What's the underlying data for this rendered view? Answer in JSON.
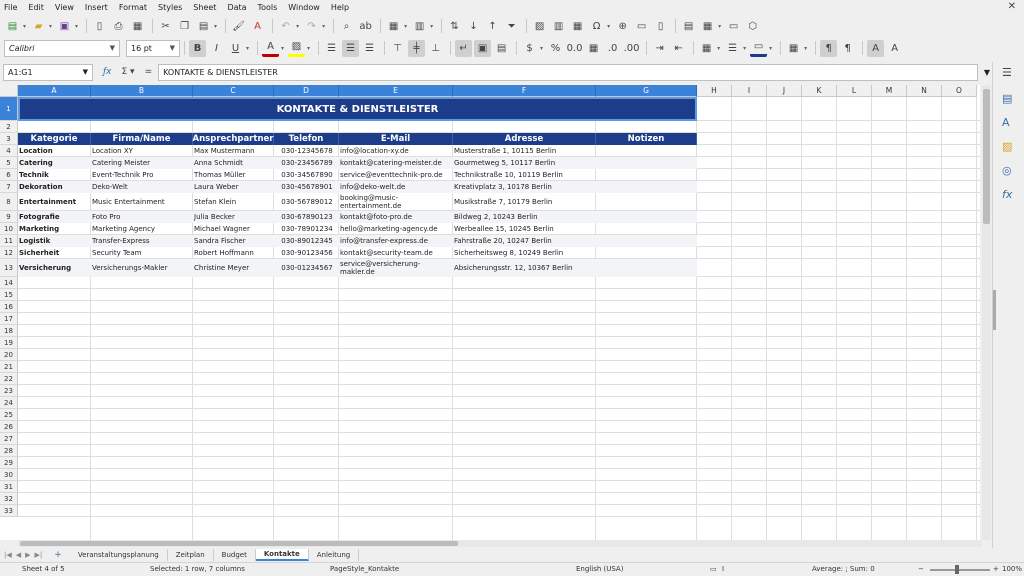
{
  "menu": [
    "File",
    "Edit",
    "View",
    "Insert",
    "Format",
    "Styles",
    "Sheet",
    "Data",
    "Tools",
    "Window",
    "Help"
  ],
  "font": {
    "name": "Calibri",
    "size": "16 pt"
  },
  "formula_bar": {
    "name_box": "A1:G1",
    "content": "KONTAKTE & DIENSTLEISTER"
  },
  "columns": [
    "A",
    "B",
    "C",
    "D",
    "E",
    "F",
    "G",
    "H",
    "I",
    "J",
    "K",
    "L",
    "M",
    "N",
    "O"
  ],
  "rows": [
    "1",
    "2",
    "3",
    "4",
    "5",
    "6",
    "7",
    "8",
    "9",
    "10",
    "11",
    "12",
    "13",
    "14",
    "15",
    "16",
    "17",
    "18",
    "19",
    "20",
    "21",
    "22",
    "23",
    "24",
    "25",
    "26",
    "27",
    "28",
    "29",
    "30",
    "31",
    "32",
    "33"
  ],
  "sheet": {
    "title": "KONTAKTE & DIENSTLEISTER",
    "headers": [
      "Kategorie",
      "Firma/Name",
      "Ansprechpartner",
      "Telefon",
      "E-Mail",
      "Adresse",
      "Notizen"
    ],
    "data": [
      [
        "Location",
        "Location XY",
        "Max Mustermann",
        "030-12345678",
        "info@location-xy.de",
        "Musterstraße 1, 10115 Berlin",
        ""
      ],
      [
        "Catering",
        "Catering Meister",
        "Anna Schmidt",
        "030-23456789",
        "kontakt@catering-meister.de",
        "Gourmetweg 5, 10117 Berlin",
        ""
      ],
      [
        "Technik",
        "Event-Technik Pro",
        "Thomas Müller",
        "030-34567890",
        "service@eventtechnik-pro.de",
        "Technikstraße 10, 10119 Berlin",
        ""
      ],
      [
        "Dekoration",
        "Deko-Welt",
        "Laura Weber",
        "030-45678901",
        "info@deko-welt.de",
        "Kreativplatz 3, 10178 Berlin",
        ""
      ],
      [
        "Entertainment",
        "Music Entertainment",
        "Stefan Klein",
        "030-56789012",
        "booking@music-entertainment.de",
        "Musikstraße 7, 10179 Berlin",
        ""
      ],
      [
        "Fotografie",
        "Foto Pro",
        "Julia Becker",
        "030-67890123",
        "kontakt@foto-pro.de",
        "Bildweg 2, 10243 Berlin",
        ""
      ],
      [
        "Marketing",
        "Marketing Agency",
        "Michael Wagner",
        "030-78901234",
        "hello@marketing-agency.de",
        "Werbeallee 15, 10245 Berlin",
        ""
      ],
      [
        "Logistik",
        "Transfer-Express",
        "Sandra Fischer",
        "030-89012345",
        "info@transfer-express.de",
        "Fahrstraße 20, 10247 Berlin",
        ""
      ],
      [
        "Sicherheit",
        "Security Team",
        "Robert Hoffmann",
        "030-90123456",
        "kontakt@security-team.de",
        "Sicherheitsweg 8, 10249 Berlin",
        ""
      ],
      [
        "Versicherung",
        "Versicherungs-Makler",
        "Christine Meyer",
        "030-01234567",
        "service@versicherung-makler.de",
        "Absicherungsstr. 12, 10367 Berlin",
        ""
      ]
    ]
  },
  "tabs": [
    "Veranstaltungsplanung",
    "Zeitplan",
    "Budget",
    "Kontakte",
    "Anleitung"
  ],
  "active_tab": "Kontakte",
  "status": {
    "sheet": "Sheet 4 of 5",
    "selection": "Selected: 1 row, 7 columns",
    "page_style": "PageStyle_Kontakte",
    "language": "English (USA)",
    "summary": "Average: ; Sum: 0",
    "zoom": "100%"
  }
}
